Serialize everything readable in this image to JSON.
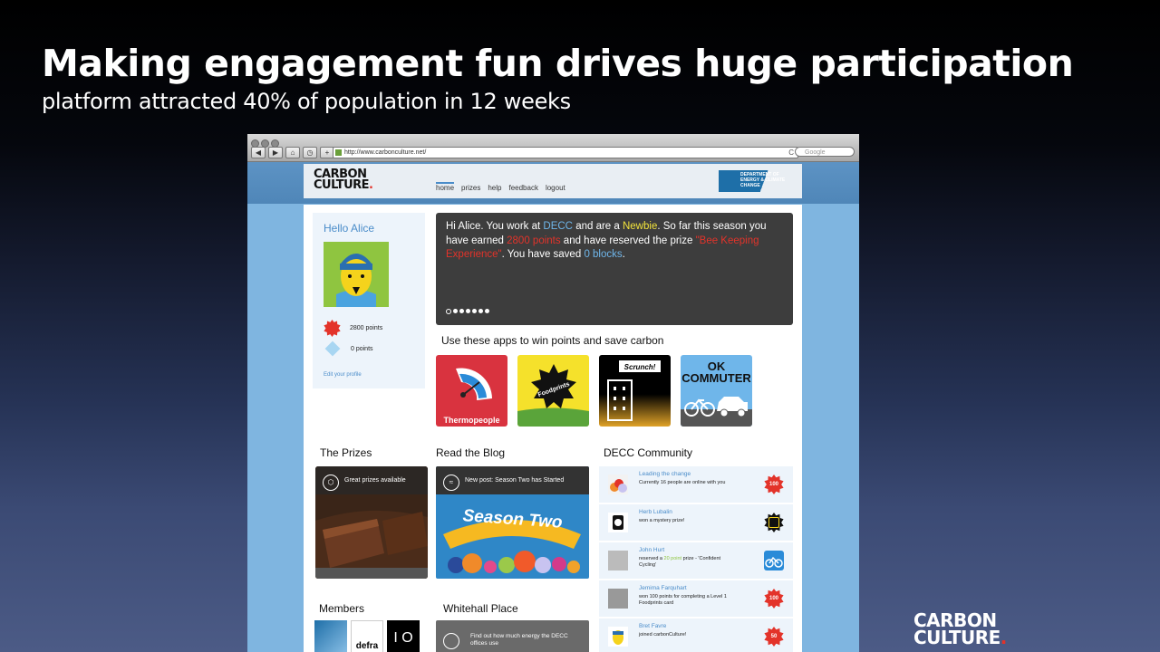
{
  "slide": {
    "title": "Making engagement fun drives huge participation",
    "subtitle": "platform attracted 40% of population in 12 weeks",
    "logo_line1": "CARB",
    "logo_o": "O",
    "logo_line1_end": "N",
    "logo_line2": "CULTURE",
    "logo_dot": "."
  },
  "browser": {
    "url": "http://www.carbonculture.net/",
    "search_placeholder": "Google",
    "reload": "C"
  },
  "site": {
    "logo_line1": "CARBON",
    "logo_line2": "CULTURE",
    "logo_dot": ".",
    "nav": [
      "home",
      "prizes",
      "help",
      "feedback",
      "logout"
    ],
    "dept_badge": "DEPARTMENT OF ENERGY & CLIMATE CHANGE"
  },
  "profile": {
    "greeting": "Hello Alice",
    "points_label": "2800 points",
    "blocks_label": "0 points",
    "edit_link": "Edit your profile"
  },
  "hero": {
    "t1": "Hi Alice. You work at ",
    "org": "DECC",
    "t2": " and are a ",
    "level": "Newbie",
    "t3": ". So far this season you have earned ",
    "points": "2800 points",
    "t4": " and have reserved the prize ",
    "prize": "\"Bee Keeping Experience\"",
    "t5": ". You have saved ",
    "blocks": "0 blocks",
    "t6": "."
  },
  "apps": {
    "heading": "Use these apps to win points and save carbon",
    "items": [
      {
        "label": "Thermopeople",
        "color": "#d9333f"
      },
      {
        "label": "Foodprints",
        "color": "#f5e12b"
      },
      {
        "label": "Scrunch!",
        "color": "#1a1a1a"
      },
      {
        "label": "OK COMMUTER",
        "color": "#6fb6ea"
      }
    ]
  },
  "sections": {
    "prizes": "The Prizes",
    "blog": "Read the Blog",
    "community": "DECC Community",
    "members": "Members",
    "whitehall": "Whitehall Place"
  },
  "prize_card": {
    "text": "Great prizes available"
  },
  "blog_card": {
    "text": "New post: Season Two has Started",
    "banner": "Season Two"
  },
  "whitehall_card": {
    "text": "Find out how much energy the DECC offices use"
  },
  "members": {
    "logo2": "defra",
    "logo3": "I O"
  },
  "community": [
    {
      "name": "Leading the change",
      "msg": "Currently 16 people are online with you",
      "badge": "100"
    },
    {
      "name": "Herb Lubalin",
      "msg": "won a mystery prize!",
      "badge": ""
    },
    {
      "name": "John Hurt",
      "msg_pre": "reserved a ",
      "msg_hl": "20 point",
      "msg_post": " prize - 'Confident Cycling'",
      "badge": ""
    },
    {
      "name": "Jemima Farquhart",
      "msg": "won 100 points for completing a Level 1 Foodprints card",
      "badge": "100"
    },
    {
      "name": "Bret Favre",
      "msg": "joined carbonCulture!",
      "badge": "50"
    }
  ]
}
